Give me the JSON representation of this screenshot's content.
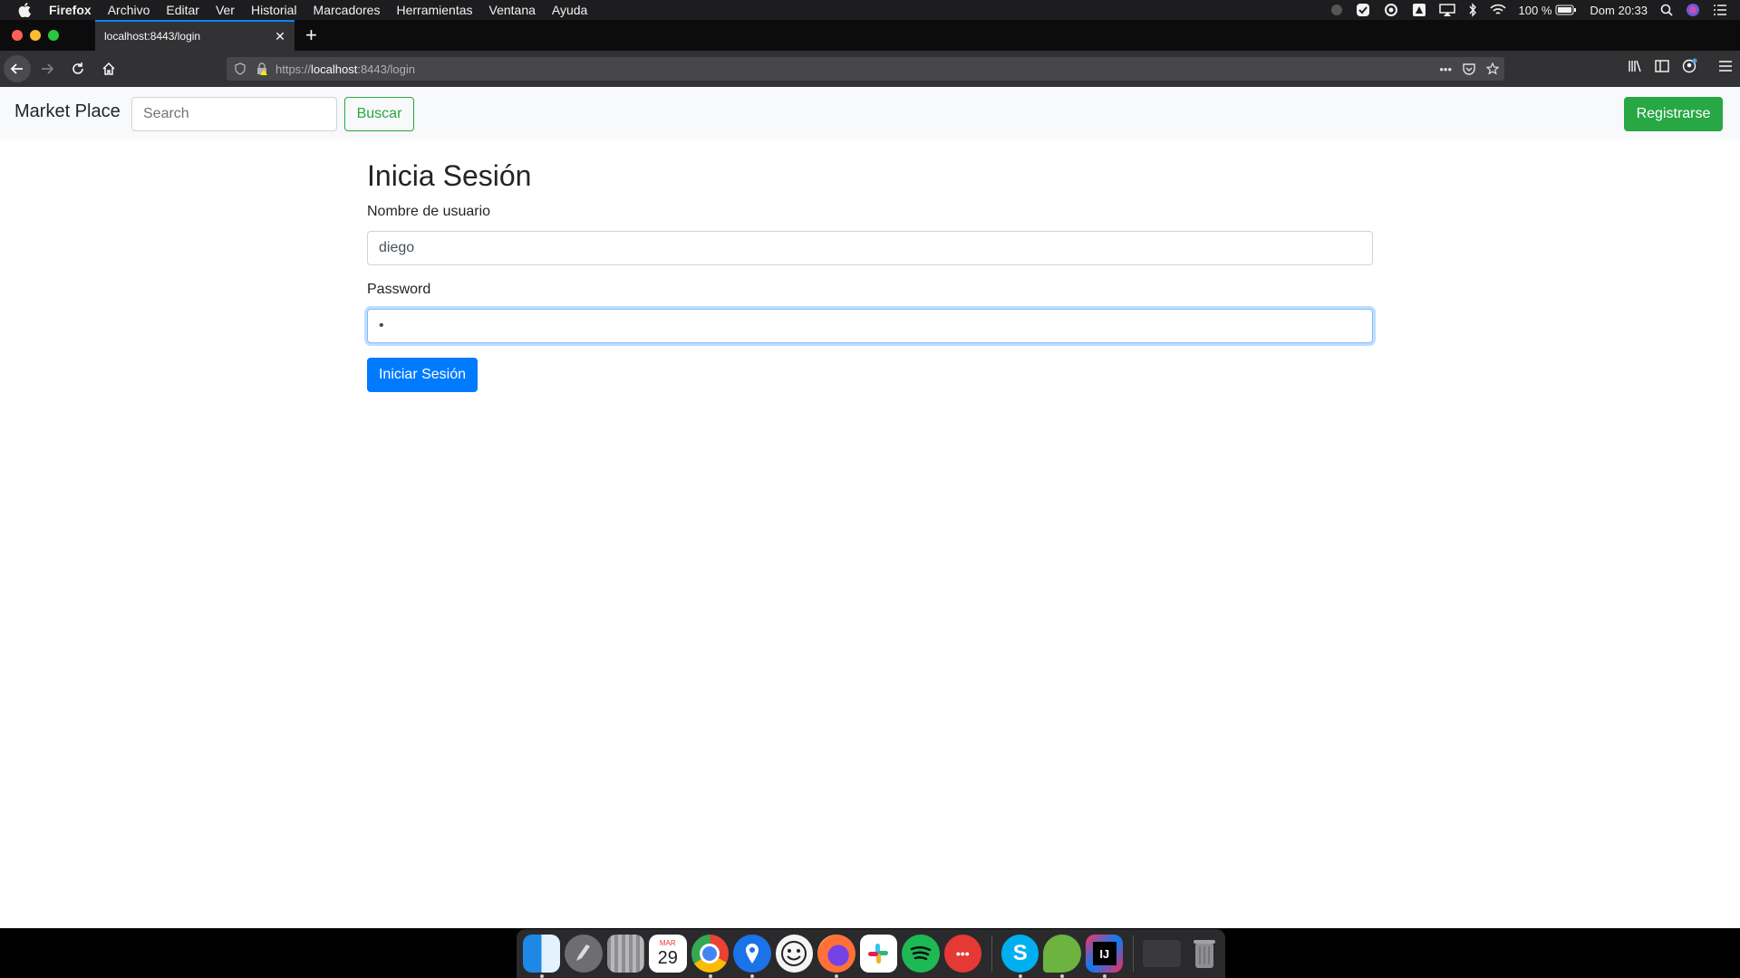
{
  "menubar": {
    "app_name": "Firefox",
    "menus": [
      "Archivo",
      "Editar",
      "Ver",
      "Historial",
      "Marcadores",
      "Herramientas",
      "Ventana",
      "Ayuda"
    ],
    "battery": "100 %",
    "clock": "Dom 20:33"
  },
  "browser": {
    "tab_title": "localhost:8443/login",
    "url_scheme": "https://",
    "url_host": "localhost",
    "url_rest": ":8443/login"
  },
  "site": {
    "brand": "Market Place",
    "search_placeholder": "Search",
    "search_button": "Buscar",
    "register_button": "Registrarse"
  },
  "login": {
    "title": "Inicia Sesión",
    "username_label": "Nombre de usuario",
    "username_value": "diego",
    "password_label": "Password",
    "password_value": "•",
    "submit_button": "Iniciar Sesión"
  },
  "dock": {
    "calendar_month": "MAR",
    "calendar_day": "29",
    "items": [
      "finder-icon",
      "launchpad-icon",
      "notes-icon",
      "calendar-icon",
      "chrome-icon",
      "maps-pin-icon",
      "smiley-icon",
      "firefox-icon",
      "slack-icon",
      "spotify-icon",
      "messages-icon",
      "skype-icon",
      "spring-icon",
      "intellij-icon",
      "screen-icon",
      "trash-icon"
    ]
  },
  "colors": {
    "primary": "#007bff",
    "success": "#28a745",
    "navbar_bg": "#f8f9fa",
    "browser_chrome": "#323234"
  }
}
